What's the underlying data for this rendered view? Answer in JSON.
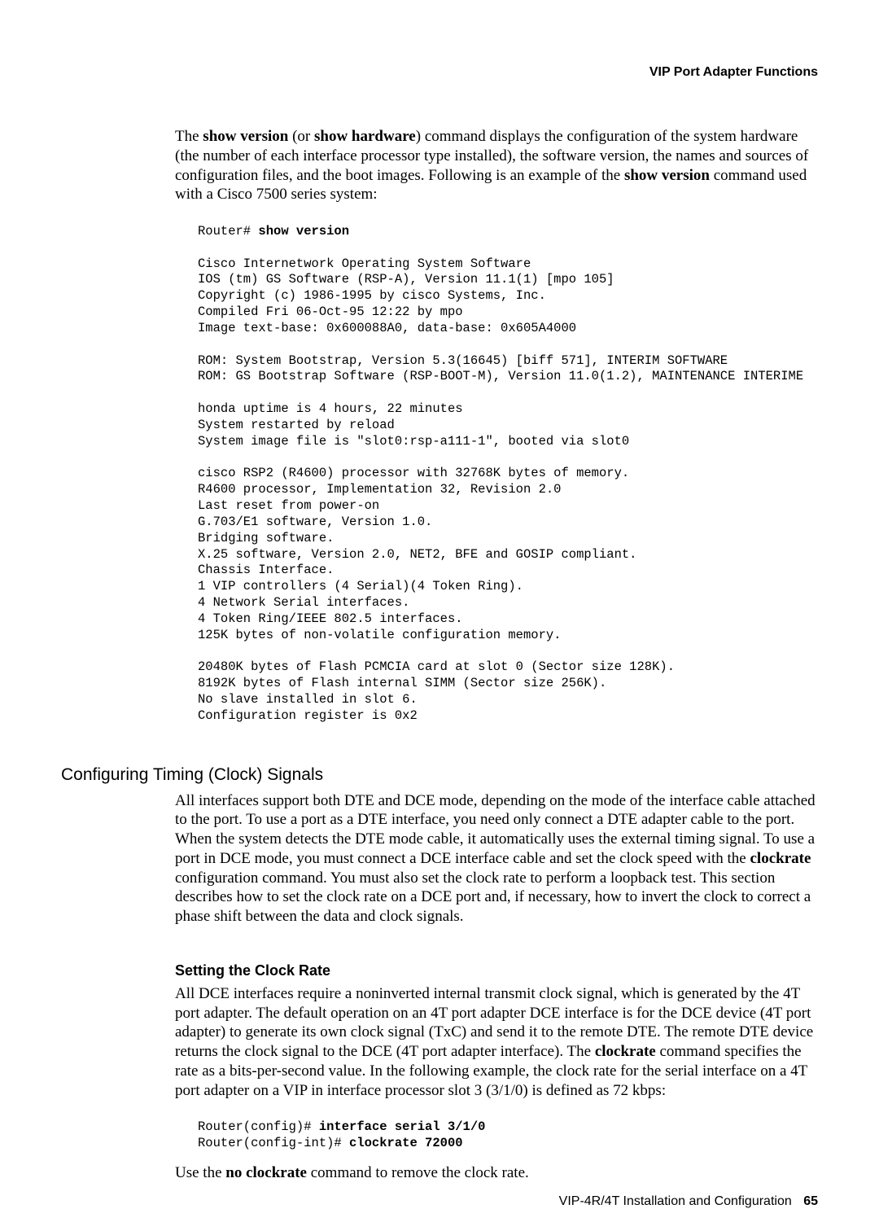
{
  "header": {
    "running_title": "VIP Port Adapter Functions"
  },
  "intro": {
    "p1_a": "The ",
    "p1_b": "show version",
    "p1_c": " (or ",
    "p1_d": "show hardware",
    "p1_e": ") command displays the configuration of the system hardware (the number of each interface processor type installed), the software version, the names and sources of configuration files, and the boot images. Following is an example of the ",
    "p1_f": "show version",
    "p1_g": " command used with a Cisco 7500 series system:"
  },
  "code1": {
    "prompt1": "Router# ",
    "cmd1": "show version",
    "body": "\n\nCisco Internetwork Operating System Software\nIOS (tm) GS Software (RSP-A), Version 11.1(1) [mpo 105]\nCopyright (c) 1986-1995 by cisco Systems, Inc.\nCompiled Fri 06-Oct-95 12:22 by mpo\nImage text-base: 0x600088A0, data-base: 0x605A4000\n\nROM: System Bootstrap, Version 5.3(16645) [biff 571], INTERIM SOFTWARE\nROM: GS Bootstrap Software (RSP-BOOT-M), Version 11.0(1.2), MAINTENANCE INTERIME\n\nhonda uptime is 4 hours, 22 minutes\nSystem restarted by reload\nSystem image file is \"slot0:rsp-a111-1\", booted via slot0\n\ncisco RSP2 (R4600) processor with 32768K bytes of memory.\nR4600 processor, Implementation 32, Revision 2.0\nLast reset from power-on\nG.703/E1 software, Version 1.0.\nBridging software.\nX.25 software, Version 2.0, NET2, BFE and GOSIP compliant.\nChassis Interface.\n1 VIP controllers (4 Serial)(4 Token Ring).\n4 Network Serial interfaces.\n4 Token Ring/IEEE 802.5 interfaces.\n125K bytes of non-volatile configuration memory.\n\n20480K bytes of Flash PCMCIA card at slot 0 (Sector size 128K).\n8192K bytes of Flash internal SIMM (Sector size 256K).\nNo slave installed in slot 6.\nConfiguration register is 0x2"
  },
  "section1": {
    "heading": "Configuring Timing (Clock) Signals",
    "p_a": "All interfaces support both DTE and DCE mode, depending on the mode of the interface cable attached to the port. To use a port as a DTE interface, you need only connect a DTE adapter cable to the port. When the system detects the DTE mode cable, it automatically uses the external timing signal. To use a port in DCE mode, you must connect a DCE interface cable and set the clock speed with the ",
    "p_b": "clockrate",
    "p_c": " configuration command. You must also set the clock rate to perform a loopback test. This section describes how to set the clock rate on a DCE port and, if necessary, how to invert the clock to correct a phase shift between the data and clock signals."
  },
  "section2": {
    "heading": "Setting the Clock Rate",
    "p_a": "All DCE interfaces require a noninverted internal transmit clock signal, which is generated by the 4T port adapter. The default operation on an 4T port adapter DCE interface is for the DCE device (4T port adapter) to generate its own clock signal (TxC) and send it to the remote DTE. The remote DTE device returns the clock signal to the DCE (4T port adapter interface). The ",
    "p_b": "clockrate",
    "p_c": " command specifies the rate as a bits-per-second value. In the following example, the clock rate for the serial interface on a 4T port adapter on a VIP in interface processor slot 3 (3/1/0) is defined as 72 kbps:"
  },
  "code2": {
    "prompt1": "Router(config)# ",
    "cmd1": "interface serial 3/1/0",
    "prompt2": "\nRouter(config-int)# ",
    "cmd2": "clockrate 72000"
  },
  "closing": {
    "a": "Use the ",
    "b": "no clockrate",
    "c": " command to remove the clock rate."
  },
  "footer": {
    "title": "VIP-4R/4T Installation and Configuration",
    "page": "65"
  }
}
